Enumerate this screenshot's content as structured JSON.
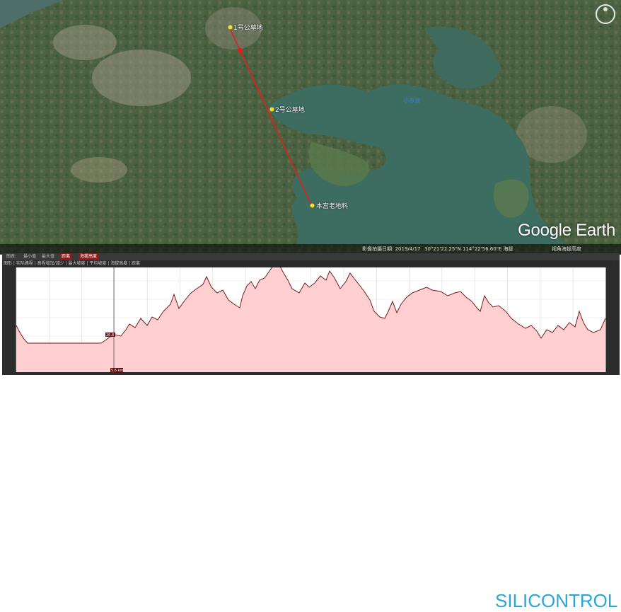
{
  "map": {
    "watermark": "Google Earth",
    "placemarks": [
      {
        "label": "1号公墓地"
      },
      {
        "label": "2号公墓地"
      },
      {
        "label": "本宫老地料"
      }
    ],
    "lake_label": "小赤湖",
    "status": {
      "imagery_date": "影像拍摄日期: 2019/4/17",
      "coords": "30°21'22.25\"N 114°22'56.60\"E 海拔",
      "altitude": "视角海拔高度"
    }
  },
  "profile": {
    "toolbar_labels": [
      "图表:",
      "最小值",
      "最大值",
      "距离",
      "海拔高度"
    ],
    "info_text": "图形 | 实际路程 | 高程增加/减少 | 最大坡度 | 平均坡度 | 海拔高度 | 距离",
    "markers": {
      "cursor_value": "26.8",
      "cursor_label": "5.6 km"
    },
    "brand": "SILICONTROL"
  },
  "colors": {
    "route": "#e02020",
    "fill": "#ffcfd2",
    "line": "#7a1a1a",
    "brand": "#2aa7d9"
  }
}
